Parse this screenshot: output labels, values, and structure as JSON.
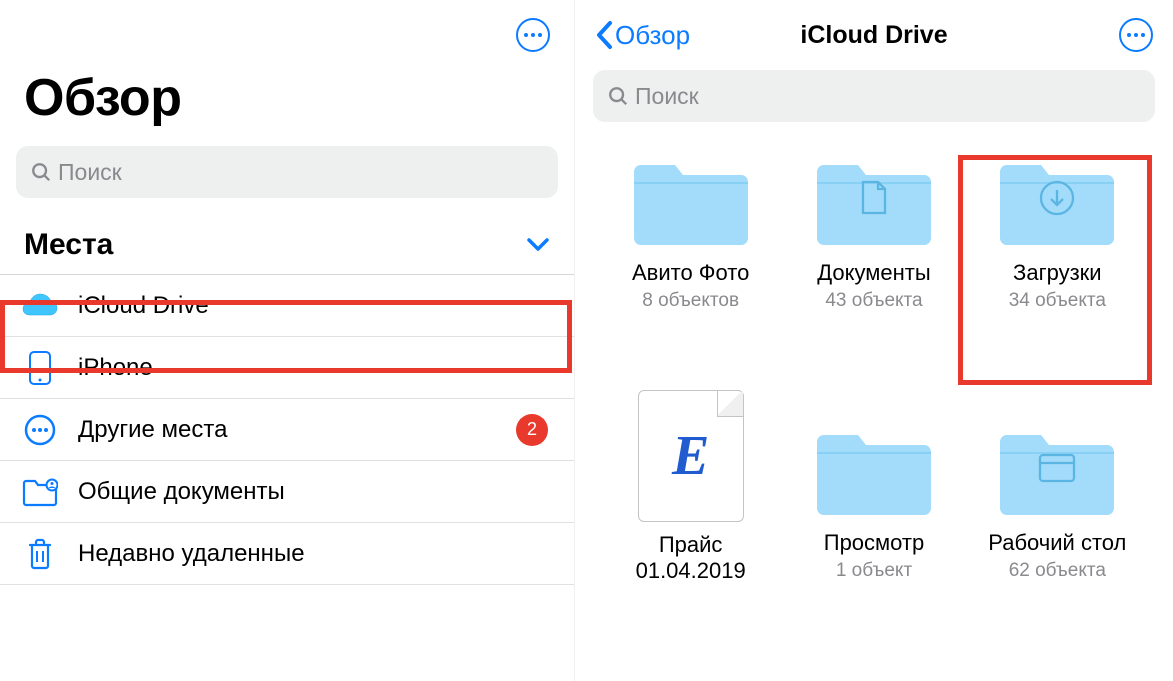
{
  "left": {
    "title": "Обзор",
    "search_placeholder": "Поиск",
    "section_title": "Места",
    "items": [
      {
        "label": "iCloud Drive",
        "icon": "icloud"
      },
      {
        "label": "iPhone",
        "icon": "iphone"
      },
      {
        "label": "Другие места",
        "icon": "more-circle",
        "badge": "2"
      },
      {
        "label": "Общие документы",
        "icon": "shared-folder"
      },
      {
        "label": "Недавно удаленные",
        "icon": "trash"
      }
    ]
  },
  "right": {
    "back_label": "Обзор",
    "title": "iCloud Drive",
    "search_placeholder": "Поиск",
    "items": [
      {
        "name": "Авито Фото",
        "sub": "8 объектов",
        "type": "folder",
        "inner": "none"
      },
      {
        "name": "Документы",
        "sub": "43 объекта",
        "type": "folder",
        "inner": "document"
      },
      {
        "name": "Загрузки",
        "sub": "34 объекта",
        "type": "folder",
        "inner": "download"
      },
      {
        "name": "Прайс 01.04.2019",
        "sub": "",
        "type": "file",
        "letter": "E"
      },
      {
        "name": "Просмотр",
        "sub": "1 объект",
        "type": "folder",
        "inner": "none"
      },
      {
        "name": "Рабочий стол",
        "sub": "62 объекта",
        "type": "folder",
        "inner": "window"
      }
    ]
  }
}
